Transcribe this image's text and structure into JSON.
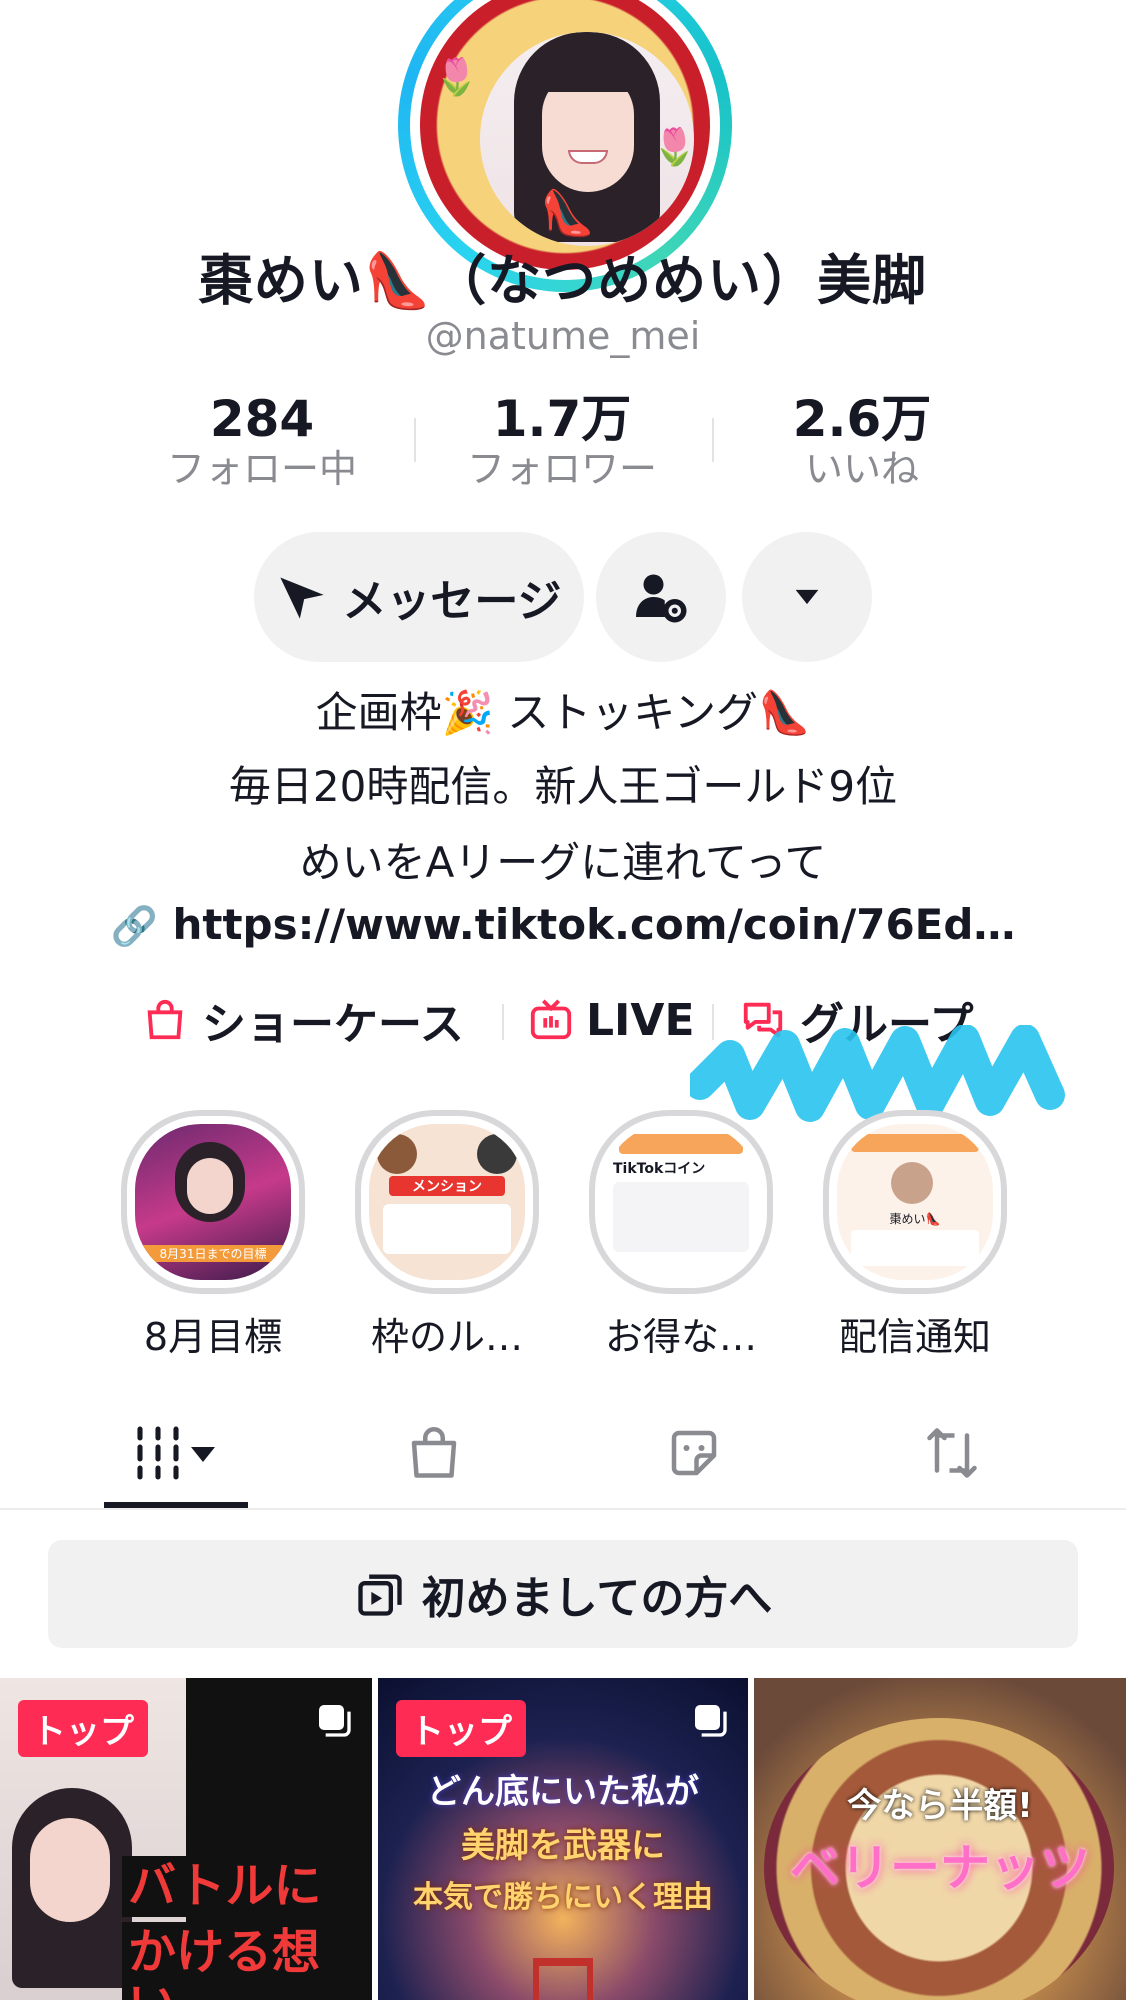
{
  "profile": {
    "name": "棗めい👠（なつめめい）美脚",
    "handle": "@natume_mei"
  },
  "stats": [
    {
      "value": "284",
      "label": "フォロー中"
    },
    {
      "value": "1.7万",
      "label": "フォロワー"
    },
    {
      "value": "2.6万",
      "label": "いいね"
    }
  ],
  "actions": {
    "message_label": "メッセージ",
    "icons": [
      "send-icon",
      "add-friend-settings-icon",
      "caret-down-icon"
    ]
  },
  "bio": {
    "line1": "企画枠🎉 ストッキング👠",
    "line2": "毎日20時配信。新人王ゴールド9位",
    "line3": "めいをAリーグに連れてって",
    "link": "https://www.tiktok.com/coin/76Ed…"
  },
  "profile_tabs": [
    {
      "label": "ショーケース",
      "icon": "shopping-bag-icon"
    },
    {
      "label": "LIVE",
      "icon": "tv-icon"
    },
    {
      "label": "グループ",
      "icon": "chat-bubbles-icon"
    }
  ],
  "highlights": [
    {
      "label": "8月目標",
      "text": "8月31日までの目標"
    },
    {
      "label": "枠のル…",
      "text": "メンション"
    },
    {
      "label": "お得な…",
      "text": "TikTokコイン"
    },
    {
      "label": "配信通知",
      "text": "棗めい👠"
    }
  ],
  "content_tabs": [
    "grid-videos-icon",
    "shop-bag-icon",
    "sticker-icon",
    "repost-icon"
  ],
  "playlist": {
    "label": "初めましての方へ",
    "icon": "playlist-icon"
  },
  "videos": [
    {
      "badge": "トップ",
      "text_lines": [
        "バトルに",
        "かける想い"
      ]
    },
    {
      "badge": "トップ",
      "text_lines": [
        "どん底にいた私が",
        "美脚を武器に",
        "本気で勝ちにいく理由"
      ]
    },
    {
      "badge": "",
      "text_lines": [
        "今なら半額!",
        "ベリーナッツ"
      ]
    }
  ],
  "colors": {
    "accent": "#fe2c55",
    "ring": "#2ad4f0",
    "muted": "#8a8b91",
    "scribble": "#29c3ef"
  }
}
